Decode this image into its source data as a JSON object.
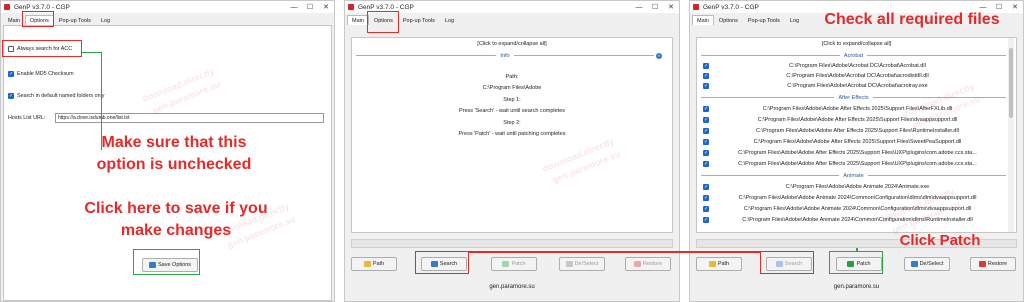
{
  "window": {
    "title": "GenP v3.7.0 - CGP",
    "minimize": "—",
    "maximize": "☐",
    "close": "✕"
  },
  "tabs": [
    "Main",
    "Options",
    "Pop-up Tools",
    "Log"
  ],
  "options": {
    "always_search_acc": {
      "label": "Always search for ACC",
      "checked": false
    },
    "enable_md5": {
      "label": "Enable MD5 Checksum",
      "checked": true
    },
    "search_default": {
      "label": "Search in default named folders only",
      "checked": true
    },
    "hosts_label": "Hosts List URL:",
    "hosts_value": "https://a.dove.isdumb.one/list.txt",
    "save_button": "Save Options"
  },
  "info": {
    "expand": "[Click to expand/collapse all]",
    "section": "Info",
    "path_label": "Path:",
    "path_value": "C:\\Program Files\\Adobe",
    "step1_label": "Step 1:",
    "step1_text": "Press 'Search' - wait until search completes",
    "step2_label": "Step 2:",
    "step2_text": "Press 'Patch' - wait until patching completes"
  },
  "buttons": {
    "path": "Path",
    "search": "Search",
    "patch": "Patch",
    "deselect": "De/Select",
    "restore": "Restore"
  },
  "files": {
    "expand": "[Click to expand/collapse all]",
    "groups": [
      {
        "name": "Acrobat",
        "items": [
          "C:\\Program Files\\Adobe\\Acrobat DC\\Acrobat\\Acrobat.dll",
          "C:\\Program Files\\Adobe\\Acrobat DC\\Acrobat\\acrodistdll.dll",
          "C:\\Program Files\\Adobe\\Acrobat DC\\Acrobat\\acrotray.exe"
        ]
      },
      {
        "name": "After Effects",
        "items": [
          "C:\\Program Files\\Adobe\\Adobe After Effects 2025\\Support Files\\AfterFXLib.dll",
          "C:\\Program Files\\Adobe\\Adobe After Effects 2025\\Support Files\\dvaappsupport.dll",
          "C:\\Program Files\\Adobe\\Adobe After Effects 2025\\Support Files\\RuntimeInstaller.dll",
          "C:\\Program Files\\Adobe\\Adobe After Effects 2025\\Support Files\\SweetPeaSupport.dll",
          "C:\\Program Files\\Adobe\\Adobe After Effects 2025\\Support Files\\UXP\\plugins\\com.adobe.ccx.sta...",
          "C:\\Program Files\\Adobe\\Adobe After Effects 2025\\Support Files\\UXP\\plugins\\com.adobe.ccx.sta..."
        ]
      },
      {
        "name": "Animate",
        "items": [
          "C:\\Program Files\\Adobe\\Adobe Animate 2024\\Animate.exe",
          "C:\\Program Files\\Adobe\\Adobe Animate 2024\\Common\\Configuration\\dlms\\dlm\\dvaappsupport.dll",
          "C:\\Program Files\\Adobe\\Adobe Animate 2024\\Common\\Configuration\\dlms\\dvaappsupport.dll",
          "C:\\Program Files\\Adobe\\Adobe Animate 2024\\Common\\Configuration\\dlms\\RuntimeInstaller.dll"
        ]
      }
    ]
  },
  "footer": "gen.paramore.su",
  "annotations": {
    "uncheck": "Make sure that this option is unchecked",
    "save": "Click here to save if you make changes",
    "check_files": "Check all required files",
    "click_patch": "Click Patch"
  },
  "watermarks": [
    "download.directly",
    "gen.paramore.su"
  ],
  "colors": {
    "annotation_red": "#e52a2a",
    "annotation_green": "#27a844",
    "accent_blue": "#1a66c9"
  }
}
